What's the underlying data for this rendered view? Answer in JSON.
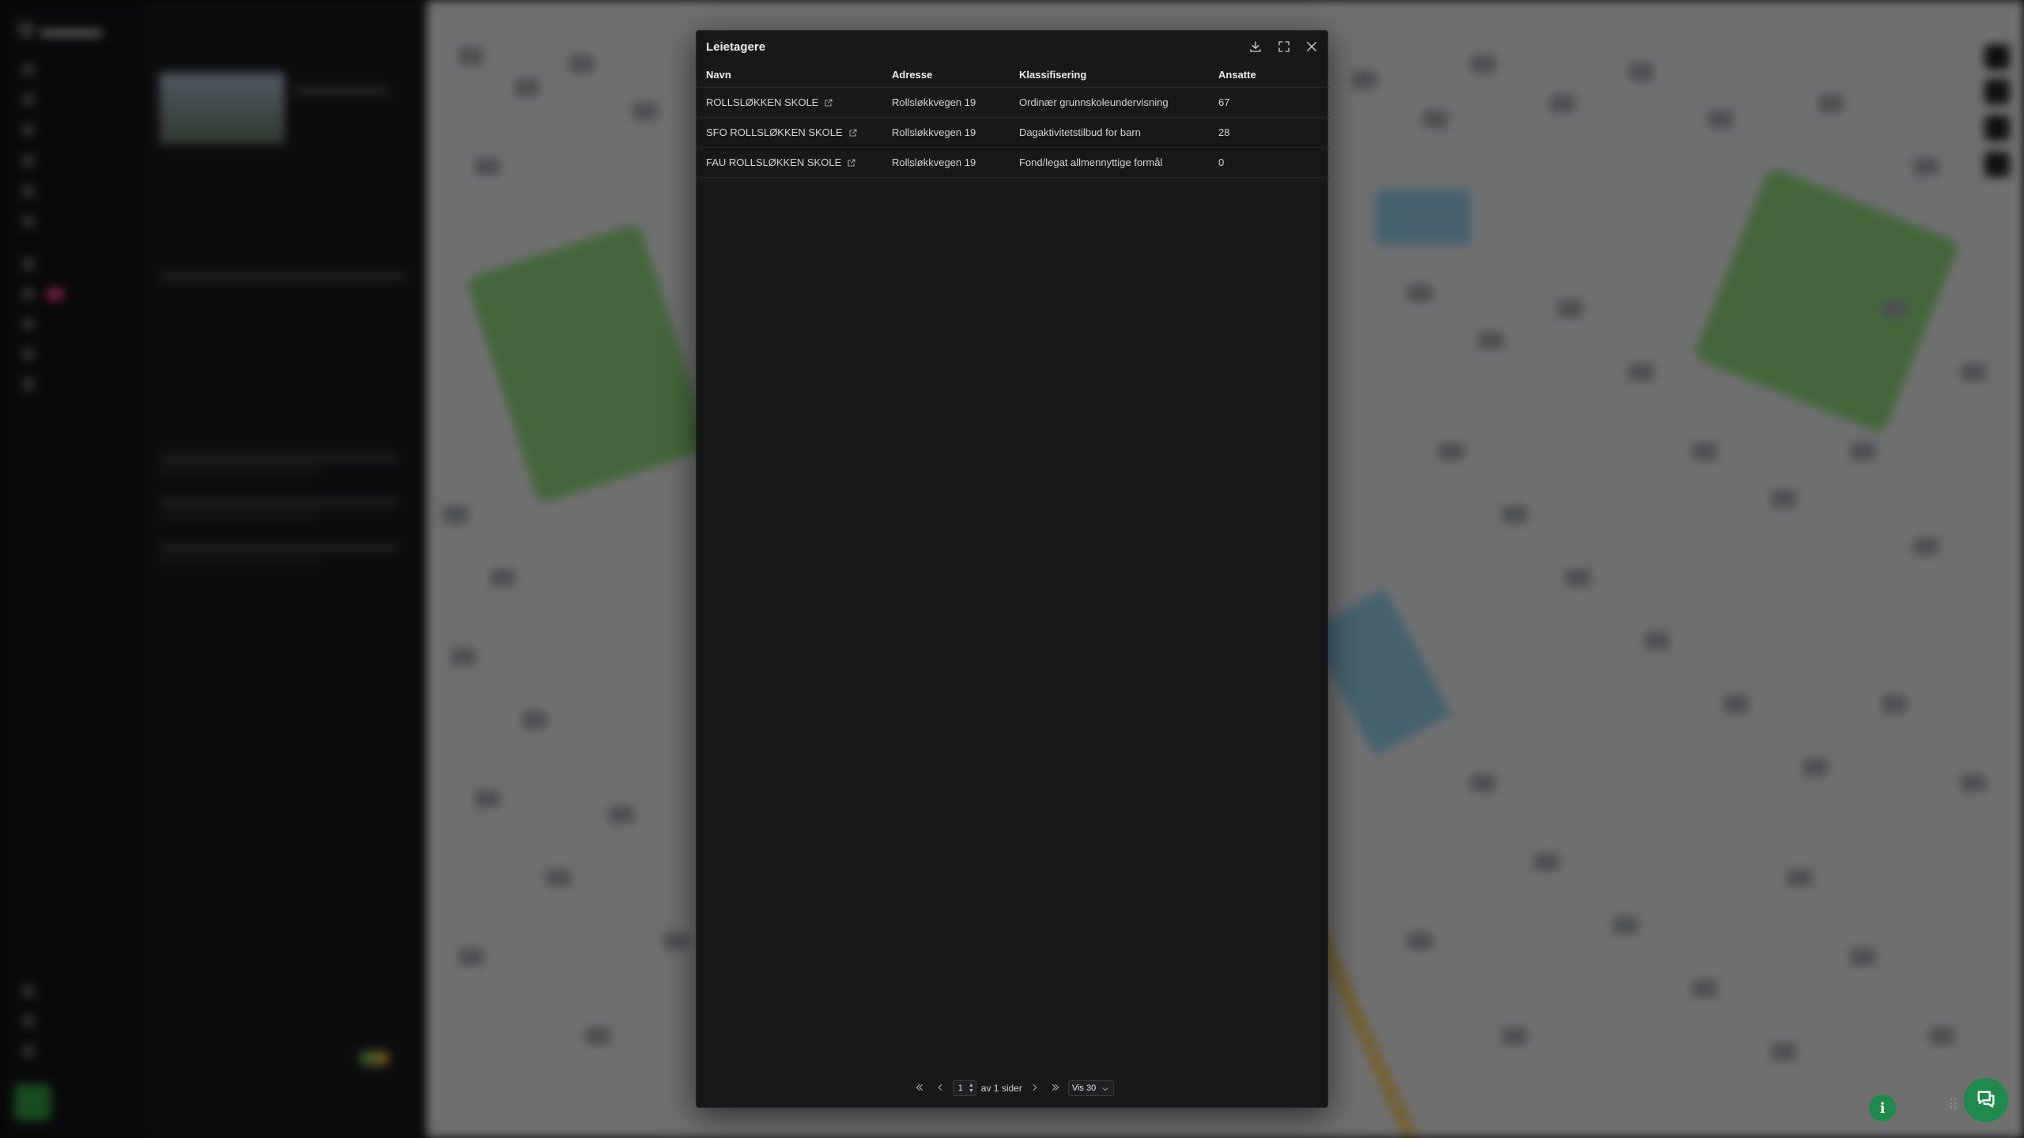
{
  "modal": {
    "title": "Leietagere",
    "actions": [
      {
        "name": "download-icon"
      },
      {
        "name": "fullscreen-icon"
      },
      {
        "name": "close-icon"
      }
    ],
    "columns": [
      "Navn",
      "Adresse",
      "Klassifisering",
      "Ansatte"
    ],
    "rows": [
      {
        "name": "ROLLSLØKKEN SKOLE",
        "address": "Rollsløkkvegen 19",
        "classification": "Ordinær grunnskoleundervisning",
        "employees": "67"
      },
      {
        "name": "SFO ROLLSLØKKEN SKOLE",
        "address": "Rollsløkkvegen 19",
        "classification": "Dagaktivitetstilbud for barn",
        "employees": "28"
      },
      {
        "name": "FAU ROLLSLØKKEN SKOLE",
        "address": "Rollsløkkvegen 19",
        "classification": "Fond/legat allmennyttige formål",
        "employees": "0"
      }
    ],
    "pagination": {
      "page": "1",
      "of_text": "av 1 sider",
      "page_size": "Vis 30"
    }
  },
  "colors": {
    "accent": "#1f8a4c",
    "modal_bg": "#17181a",
    "map_green": "#7dbb6a"
  },
  "floating": {
    "info_label": "i"
  }
}
